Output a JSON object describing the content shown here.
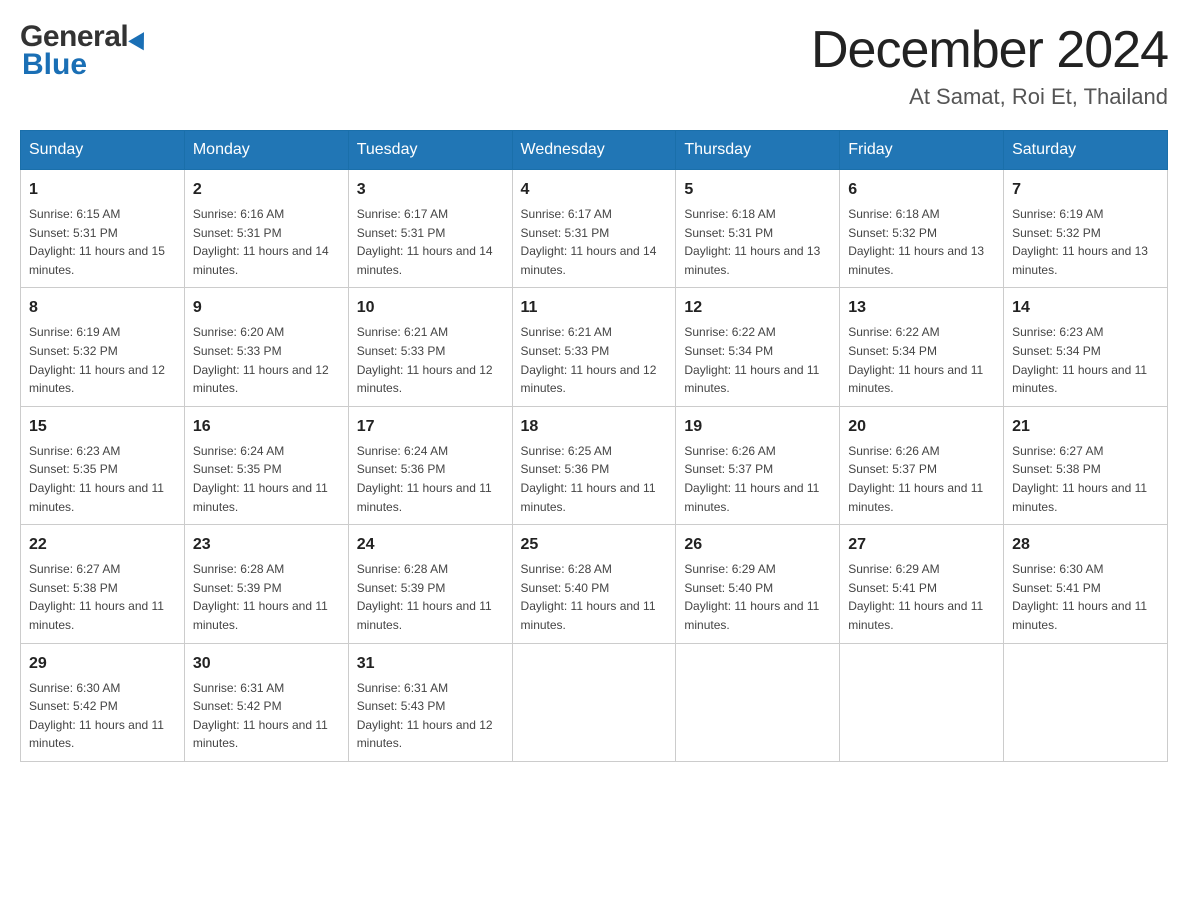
{
  "logo": {
    "general": "General",
    "blue": "Blue",
    "triangle_symbol": "▶"
  },
  "title": {
    "month_year": "December 2024",
    "location": "At Samat, Roi Et, Thailand"
  },
  "days_header": [
    "Sunday",
    "Monday",
    "Tuesday",
    "Wednesday",
    "Thursday",
    "Friday",
    "Saturday"
  ],
  "weeks": [
    {
      "days": [
        {
          "num": "1",
          "sunrise": "Sunrise: 6:15 AM",
          "sunset": "Sunset: 5:31 PM",
          "daylight": "Daylight: 11 hours and 15 minutes."
        },
        {
          "num": "2",
          "sunrise": "Sunrise: 6:16 AM",
          "sunset": "Sunset: 5:31 PM",
          "daylight": "Daylight: 11 hours and 14 minutes."
        },
        {
          "num": "3",
          "sunrise": "Sunrise: 6:17 AM",
          "sunset": "Sunset: 5:31 PM",
          "daylight": "Daylight: 11 hours and 14 minutes."
        },
        {
          "num": "4",
          "sunrise": "Sunrise: 6:17 AM",
          "sunset": "Sunset: 5:31 PM",
          "daylight": "Daylight: 11 hours and 14 minutes."
        },
        {
          "num": "5",
          "sunrise": "Sunrise: 6:18 AM",
          "sunset": "Sunset: 5:31 PM",
          "daylight": "Daylight: 11 hours and 13 minutes."
        },
        {
          "num": "6",
          "sunrise": "Sunrise: 6:18 AM",
          "sunset": "Sunset: 5:32 PM",
          "daylight": "Daylight: 11 hours and 13 minutes."
        },
        {
          "num": "7",
          "sunrise": "Sunrise: 6:19 AM",
          "sunset": "Sunset: 5:32 PM",
          "daylight": "Daylight: 11 hours and 13 minutes."
        }
      ]
    },
    {
      "days": [
        {
          "num": "8",
          "sunrise": "Sunrise: 6:19 AM",
          "sunset": "Sunset: 5:32 PM",
          "daylight": "Daylight: 11 hours and 12 minutes."
        },
        {
          "num": "9",
          "sunrise": "Sunrise: 6:20 AM",
          "sunset": "Sunset: 5:33 PM",
          "daylight": "Daylight: 11 hours and 12 minutes."
        },
        {
          "num": "10",
          "sunrise": "Sunrise: 6:21 AM",
          "sunset": "Sunset: 5:33 PM",
          "daylight": "Daylight: 11 hours and 12 minutes."
        },
        {
          "num": "11",
          "sunrise": "Sunrise: 6:21 AM",
          "sunset": "Sunset: 5:33 PM",
          "daylight": "Daylight: 11 hours and 12 minutes."
        },
        {
          "num": "12",
          "sunrise": "Sunrise: 6:22 AM",
          "sunset": "Sunset: 5:34 PM",
          "daylight": "Daylight: 11 hours and 11 minutes."
        },
        {
          "num": "13",
          "sunrise": "Sunrise: 6:22 AM",
          "sunset": "Sunset: 5:34 PM",
          "daylight": "Daylight: 11 hours and 11 minutes."
        },
        {
          "num": "14",
          "sunrise": "Sunrise: 6:23 AM",
          "sunset": "Sunset: 5:34 PM",
          "daylight": "Daylight: 11 hours and 11 minutes."
        }
      ]
    },
    {
      "days": [
        {
          "num": "15",
          "sunrise": "Sunrise: 6:23 AM",
          "sunset": "Sunset: 5:35 PM",
          "daylight": "Daylight: 11 hours and 11 minutes."
        },
        {
          "num": "16",
          "sunrise": "Sunrise: 6:24 AM",
          "sunset": "Sunset: 5:35 PM",
          "daylight": "Daylight: 11 hours and 11 minutes."
        },
        {
          "num": "17",
          "sunrise": "Sunrise: 6:24 AM",
          "sunset": "Sunset: 5:36 PM",
          "daylight": "Daylight: 11 hours and 11 minutes."
        },
        {
          "num": "18",
          "sunrise": "Sunrise: 6:25 AM",
          "sunset": "Sunset: 5:36 PM",
          "daylight": "Daylight: 11 hours and 11 minutes."
        },
        {
          "num": "19",
          "sunrise": "Sunrise: 6:26 AM",
          "sunset": "Sunset: 5:37 PM",
          "daylight": "Daylight: 11 hours and 11 minutes."
        },
        {
          "num": "20",
          "sunrise": "Sunrise: 6:26 AM",
          "sunset": "Sunset: 5:37 PM",
          "daylight": "Daylight: 11 hours and 11 minutes."
        },
        {
          "num": "21",
          "sunrise": "Sunrise: 6:27 AM",
          "sunset": "Sunset: 5:38 PM",
          "daylight": "Daylight: 11 hours and 11 minutes."
        }
      ]
    },
    {
      "days": [
        {
          "num": "22",
          "sunrise": "Sunrise: 6:27 AM",
          "sunset": "Sunset: 5:38 PM",
          "daylight": "Daylight: 11 hours and 11 minutes."
        },
        {
          "num": "23",
          "sunrise": "Sunrise: 6:28 AM",
          "sunset": "Sunset: 5:39 PM",
          "daylight": "Daylight: 11 hours and 11 minutes."
        },
        {
          "num": "24",
          "sunrise": "Sunrise: 6:28 AM",
          "sunset": "Sunset: 5:39 PM",
          "daylight": "Daylight: 11 hours and 11 minutes."
        },
        {
          "num": "25",
          "sunrise": "Sunrise: 6:28 AM",
          "sunset": "Sunset: 5:40 PM",
          "daylight": "Daylight: 11 hours and 11 minutes."
        },
        {
          "num": "26",
          "sunrise": "Sunrise: 6:29 AM",
          "sunset": "Sunset: 5:40 PM",
          "daylight": "Daylight: 11 hours and 11 minutes."
        },
        {
          "num": "27",
          "sunrise": "Sunrise: 6:29 AM",
          "sunset": "Sunset: 5:41 PM",
          "daylight": "Daylight: 11 hours and 11 minutes."
        },
        {
          "num": "28",
          "sunrise": "Sunrise: 6:30 AM",
          "sunset": "Sunset: 5:41 PM",
          "daylight": "Daylight: 11 hours and 11 minutes."
        }
      ]
    },
    {
      "days": [
        {
          "num": "29",
          "sunrise": "Sunrise: 6:30 AM",
          "sunset": "Sunset: 5:42 PM",
          "daylight": "Daylight: 11 hours and 11 minutes."
        },
        {
          "num": "30",
          "sunrise": "Sunrise: 6:31 AM",
          "sunset": "Sunset: 5:42 PM",
          "daylight": "Daylight: 11 hours and 11 minutes."
        },
        {
          "num": "31",
          "sunrise": "Sunrise: 6:31 AM",
          "sunset": "Sunset: 5:43 PM",
          "daylight": "Daylight: 11 hours and 12 minutes."
        },
        null,
        null,
        null,
        null
      ]
    }
  ]
}
